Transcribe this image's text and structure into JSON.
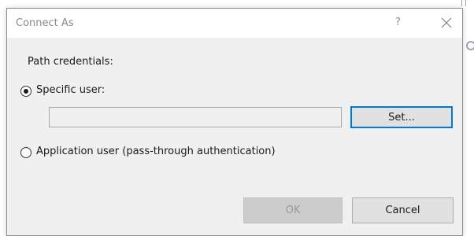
{
  "window": {
    "title": "Connect As",
    "help_label": "?",
    "close_icon": "close-icon"
  },
  "content": {
    "section_label": "Path credentials:",
    "options": [
      {
        "label": "Specific user:",
        "selected": true
      },
      {
        "label": "Application user (pass-through authentication)",
        "selected": false
      }
    ],
    "user_value": "",
    "set_button_label": "Set..."
  },
  "footer": {
    "ok_label": "OK",
    "ok_enabled": false,
    "cancel_label": "Cancel"
  },
  "colors": {
    "dialog_bg": "#f0f0f0",
    "focus_accent": "#0078d7",
    "title_text": "#8a8a8a"
  }
}
